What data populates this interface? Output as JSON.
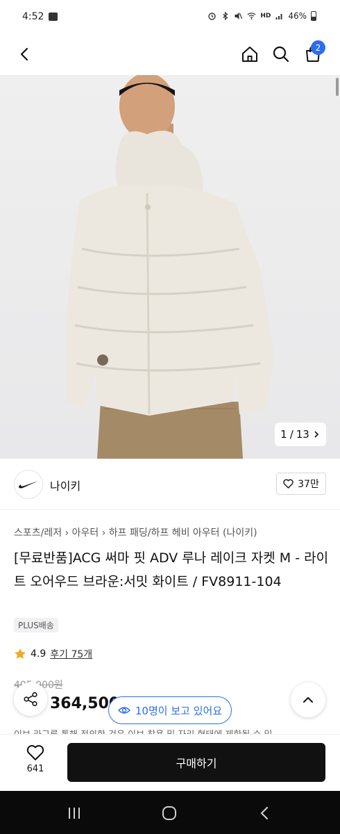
{
  "status_bar": {
    "time": "4:52",
    "battery": "46%",
    "network": "HD"
  },
  "header": {
    "cart_count": "2"
  },
  "gallery": {
    "current": "1",
    "separator": "/",
    "total": "13"
  },
  "brand": {
    "name": "나이키",
    "likes": "37만"
  },
  "breadcrumb": [
    "스포츠/레저",
    "아우터",
    "하프 패딩/하프 헤비 아우터 (나이키)"
  ],
  "product": {
    "title": "[무료반품]ACG 써마 핏 ADV 루나 레이크 자켓 M - 라이트 오어우드 브라운:서밋 화이트 / FV8911-104",
    "shipping_badge": "PLUS배송",
    "rating": "4.9",
    "reviews": "후기 75개",
    "original_price": "405,000원",
    "price": "364,500"
  },
  "viewers": "10명이 보고 있어요",
  "description_cutoff": "이브 라그루 통해 정의한 것은 이브 착용 및 자리 형태에 제한될 수 있",
  "actions": {
    "wish_count": "641",
    "buy_label": "구매하기"
  },
  "colors": {
    "accent": "#2a6ef2",
    "buy_button": "#111111",
    "jacket": "#ece8e0",
    "pants": "#a58a68"
  }
}
